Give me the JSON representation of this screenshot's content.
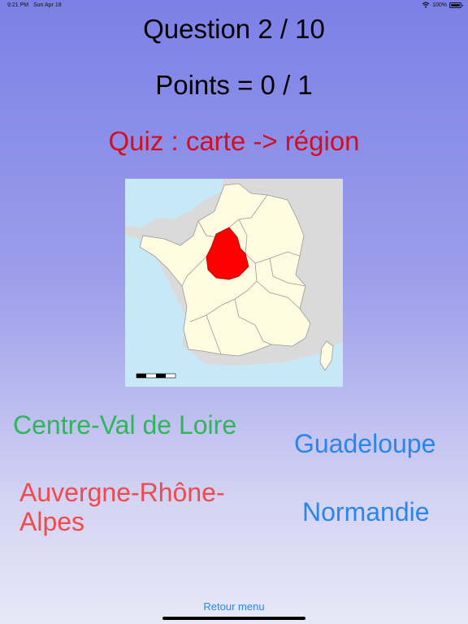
{
  "status_bar": {
    "time": "9:21 PM",
    "date": "Sun Apr 18",
    "battery_text": "100%",
    "battery_level": 1.0
  },
  "header": {
    "question": "Question 2 / 10",
    "points": "Points = 0 / 1",
    "quiz_title": "Quiz : carte -> région"
  },
  "map": {
    "highlight_color": "#ff0000",
    "land_color": "#fffbe0",
    "neighbour_color": "#dadada"
  },
  "answers": [
    "Centre-Val de Loire",
    "Auvergne-Rhône-Alpes",
    "Guadeloupe",
    "Normandie"
  ],
  "footer": {
    "back_label": "Retour menu"
  }
}
